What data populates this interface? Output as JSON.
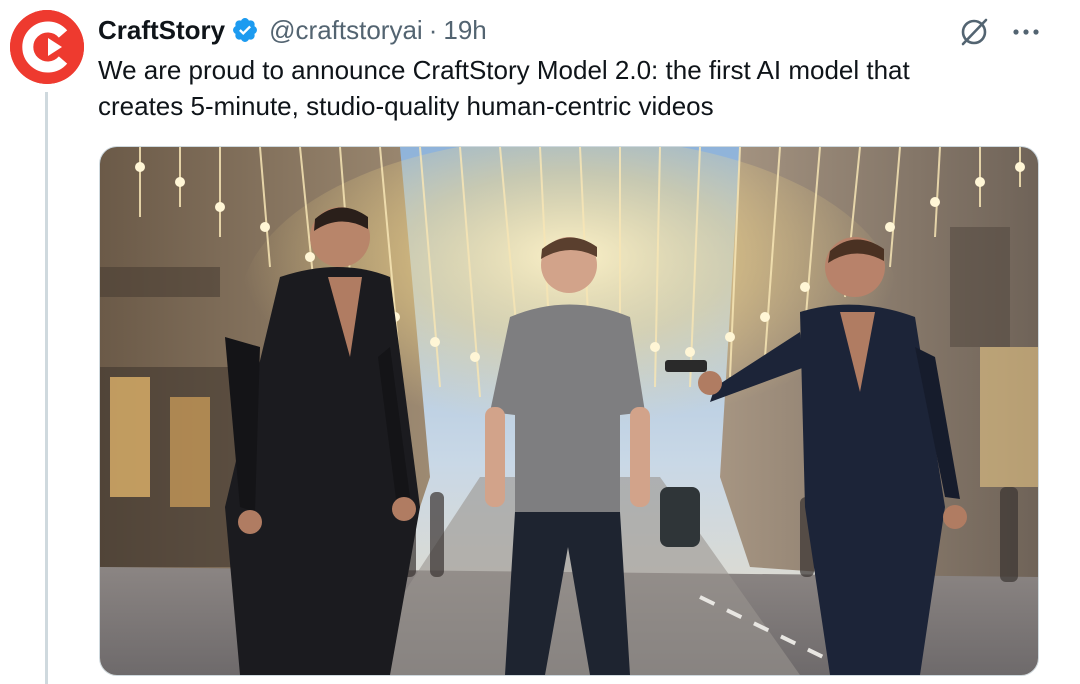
{
  "tweet": {
    "author_name": "CraftStory",
    "verified": true,
    "handle": "@craftstoryai",
    "separator": "·",
    "time": "19h",
    "text_line1": "We are proud to announce CraftStory Model 2.0: the first AI model that",
    "text_line2": "creates 5-minute, studio-quality human-centric videos"
  },
  "icons": {
    "avatar": "craftstory-logo",
    "verified": "verified-badge-icon",
    "grok": "grok-icon",
    "more": "more-options-icon"
  },
  "colors": {
    "brand_red": "#ee3a2f",
    "verified_blue": "#1d9bf0",
    "secondary_text": "#536471"
  }
}
